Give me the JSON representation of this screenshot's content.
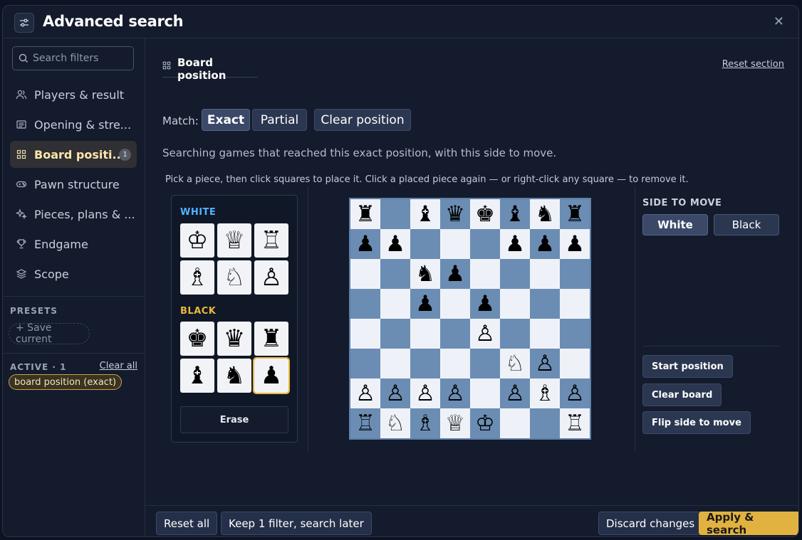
{
  "header": {
    "title": "Advanced search"
  },
  "sidebar": {
    "search_placeholder": "Search filters",
    "items": [
      {
        "label": "Players & result",
        "icon": "users-icon"
      },
      {
        "label": "Opening & stre...",
        "icon": "book-icon"
      },
      {
        "label": "Board positi...",
        "icon": "grid-icon",
        "badge": "1",
        "active": true
      },
      {
        "label": "Pawn structure",
        "icon": "gamepad-icon"
      },
      {
        "label": "Pieces, plans & ...",
        "icon": "sparkle-icon"
      },
      {
        "label": "Endgame",
        "icon": "trophy-icon"
      },
      {
        "label": "Scope",
        "icon": "layers-icon"
      }
    ],
    "presets_label": "PRESETS",
    "save_current": "+ Save current",
    "active_label": "ACTIVE · 1",
    "clear_all": "Clear all",
    "active_chip": "board position (exact)"
  },
  "main": {
    "section_title": "Board position",
    "reset_section": "Reset section",
    "match_label": "Match:",
    "match_exact": "Exact",
    "match_partial": "Partial",
    "clear_position": "Clear position",
    "description": "Searching games that reached this exact position, with this side to move.",
    "hint": "Pick a piece, then click squares to place it. Click a placed piece again — or right-click any square — to remove it.",
    "palette": {
      "white_label": "WHITE",
      "black_label": "BLACK",
      "white_pieces": [
        "♔",
        "♕",
        "♖",
        "♗",
        "♘",
        "♙"
      ],
      "black_pieces": [
        "♚",
        "♛",
        "♜",
        "♝",
        "♞",
        "♟"
      ],
      "selected": "black-pawn",
      "erase": "Erase"
    },
    "side_to_move": {
      "label": "SIDE TO MOVE",
      "white": "White",
      "black": "Black",
      "selected": "White"
    },
    "start_position": "Start position",
    "clear_board": "Clear board",
    "flip_side": "Flip side to move"
  },
  "board": [
    [
      "♜",
      "",
      "♝",
      "♛",
      "♚",
      "♝",
      "♞",
      "♜"
    ],
    [
      "♟",
      "♟",
      "",
      "",
      "",
      "♟",
      "♟",
      "♟"
    ],
    [
      "",
      "",
      "♞",
      "♟",
      "",
      "",
      "",
      ""
    ],
    [
      "",
      "",
      "♟",
      "",
      "♟",
      "",
      "",
      ""
    ],
    [
      "",
      "",
      "",
      "",
      "♙",
      "",
      "",
      ""
    ],
    [
      "",
      "",
      "",
      "",
      "",
      "♘",
      "♙",
      ""
    ],
    [
      "♙",
      "♙",
      "♙",
      "♙",
      "",
      "♙",
      "♗",
      "♙"
    ],
    [
      "♖",
      "♘",
      "♗",
      "♕",
      "♔",
      "",
      "",
      "♖"
    ]
  ],
  "footer": {
    "reset_all": "Reset all",
    "keep": "Keep 1 filter, search later",
    "discard": "Discard changes",
    "apply": "Apply & search"
  },
  "colors": {
    "accent": "#e2b240",
    "board_dark": "#6b8db4",
    "board_light": "#eef2f8",
    "white_label": "#4fb3ff",
    "black_label": "#e8b93a"
  }
}
